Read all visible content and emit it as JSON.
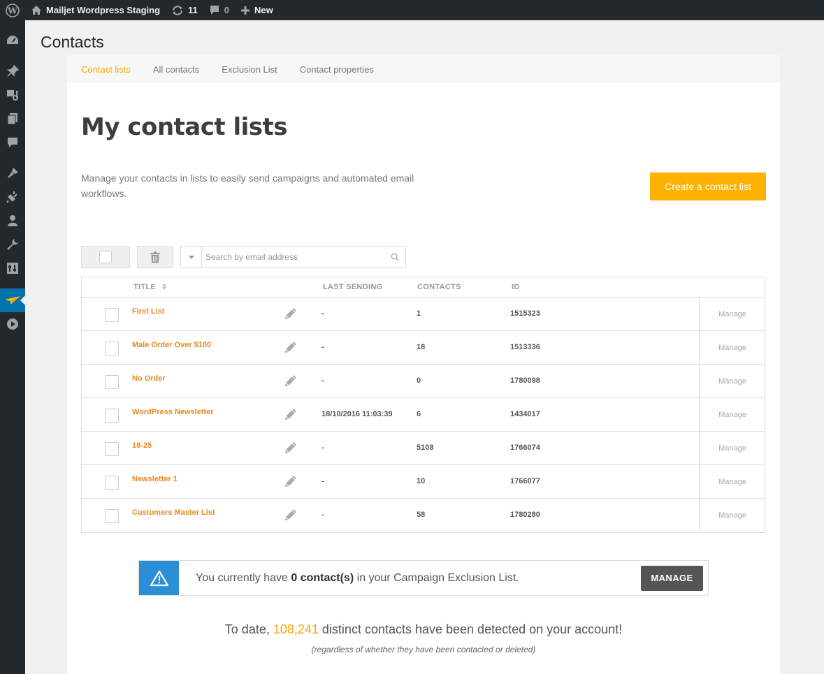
{
  "adminbar": {
    "site_name": "Mailjet Wordpress Staging",
    "updates_count": "11",
    "comments_count": "0",
    "new_label": "New"
  },
  "page": {
    "heading": "Contacts"
  },
  "tabs": [
    {
      "label": "Contact lists",
      "active": true
    },
    {
      "label": "All contacts",
      "active": false
    },
    {
      "label": "Exclusion List",
      "active": false
    },
    {
      "label": "Contact properties",
      "active": false
    }
  ],
  "main": {
    "title": "My contact lists",
    "intro": "Manage your contacts in lists to easily send campaigns and automated email workflows.",
    "create_button": "Create a contact list",
    "search_placeholder": "Search by email address"
  },
  "table": {
    "headers": {
      "title": "TITLE",
      "last_sending": "LAST SENDING",
      "contacts": "CONTACTS",
      "id": "ID"
    },
    "rows": [
      {
        "name": "First List",
        "last_sending": "-",
        "contacts": "1",
        "id": "1515323",
        "action": "Manage"
      },
      {
        "name": "Male Order Over $100",
        "last_sending": "-",
        "contacts": "18",
        "id": "1513336",
        "action": "Manage"
      },
      {
        "name": "No Order",
        "last_sending": "-",
        "contacts": "0",
        "id": "1780098",
        "action": "Manage"
      },
      {
        "name": "WordPress Newsletter",
        "last_sending": "18/10/2016 11:03:39",
        "contacts": "6",
        "id": "1434017",
        "action": "Manage"
      },
      {
        "name": "18-25",
        "last_sending": "-",
        "contacts": "5108",
        "id": "1766074",
        "action": "Manage"
      },
      {
        "name": "Newsletter 1",
        "last_sending": "-",
        "contacts": "10",
        "id": "1766077",
        "action": "Manage"
      },
      {
        "name": "Customers Master List",
        "last_sending": "-",
        "contacts": "58",
        "id": "1780280",
        "action": "Manage"
      }
    ]
  },
  "exclusion": {
    "prefix": "You currently have ",
    "count": "0 contact(s)",
    "suffix": " in your Campaign Exclusion List.",
    "button": "MANAGE"
  },
  "totals": {
    "prefix": "To date, ",
    "number": "108,241",
    "suffix": " distinct contacts have been detected on your account!",
    "note": "(regardless of whether they have been contacted or deleted)"
  },
  "icons": {
    "adminbar": [
      "wordpress-logo-icon",
      "home-icon",
      "updates-icon",
      "comment-icon",
      "plus-icon"
    ],
    "sidemenu": [
      "dashboard-icon",
      "pin-icon",
      "media-icon",
      "pages-icon",
      "comments-icon",
      "appearance-icon",
      "plugins-icon",
      "users-icon",
      "tools-icon",
      "settings-icon",
      "mailjet-icon",
      "play-icon"
    ]
  },
  "colors": {
    "accent": "#ffb100",
    "link": "#e8891c",
    "admin_bar": "#23282d",
    "warning_blue": "#2a8fd6"
  }
}
